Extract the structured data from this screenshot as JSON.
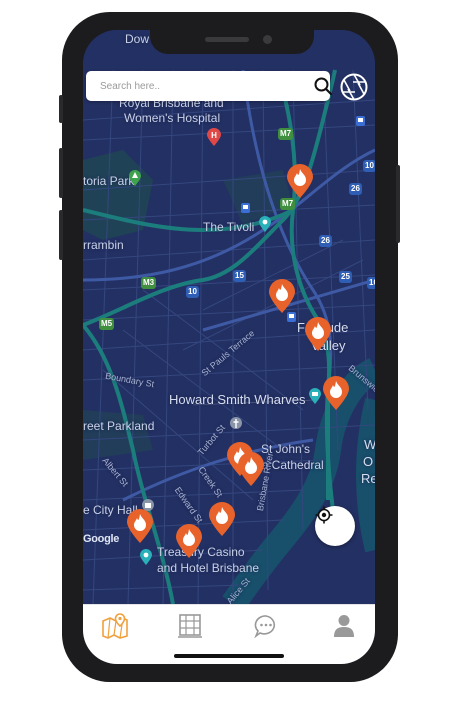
{
  "search": {
    "placeholder": "Search here.."
  },
  "map": {
    "labels": {
      "down": "Dow",
      "hospital_line1": "Royal Brisbane and",
      "hospital_line2": "Women's Hospital",
      "victoria_park": "toria Park",
      "herston": "rrambin",
      "the_tivoli": "The Tivoli",
      "fortitude": "Fortitude",
      "valley": "Valley",
      "boundary_st": "Boundary St",
      "st_pauls": "St Pauls Terrace",
      "brunswick": "Brunswick",
      "howard_smith": "Howard Smith Wharves",
      "parkland": "reet Parkland",
      "turbot_st": "Turbot St",
      "st_johns_line1": "St John's",
      "st_johns_line2": "an Cathedral",
      "albert_st": "Albert St",
      "creek_st": "Creek St",
      "edward_st": "Edward St",
      "city_hall": "e City Hall",
      "brisbane_river": "Brisbane River",
      "treasury_line1": "Treasury Casino",
      "treasury_line2": "and Hotel Brisbane",
      "alice_st": "Alice St",
      "google": "Google",
      "right_w": "W",
      "right_o": "O",
      "right_re": "Re"
    },
    "shields": {
      "m7_a": "M7",
      "m7_b": "M7",
      "m3": "M3",
      "m5": "M5",
      "r10": "10",
      "r26": "26",
      "r15": "15",
      "r10b": "10",
      "r25": "25",
      "r26b": "26",
      "r10c": "10"
    },
    "pin_color": "#e8632b",
    "pin_count": 10
  },
  "tabs": [
    {
      "name": "map",
      "icon": "map-pin-icon",
      "active": true
    },
    {
      "name": "venues",
      "icon": "building-icon",
      "active": false
    },
    {
      "name": "chat",
      "icon": "chat-bubble-icon",
      "active": false
    },
    {
      "name": "profile",
      "icon": "user-icon",
      "active": false
    }
  ],
  "colors": {
    "accent": "#f0a03c",
    "map_bg": "#233063",
    "river": "#1a7a7a",
    "road": "#3a4d8f",
    "pin": "#e8632b"
  }
}
